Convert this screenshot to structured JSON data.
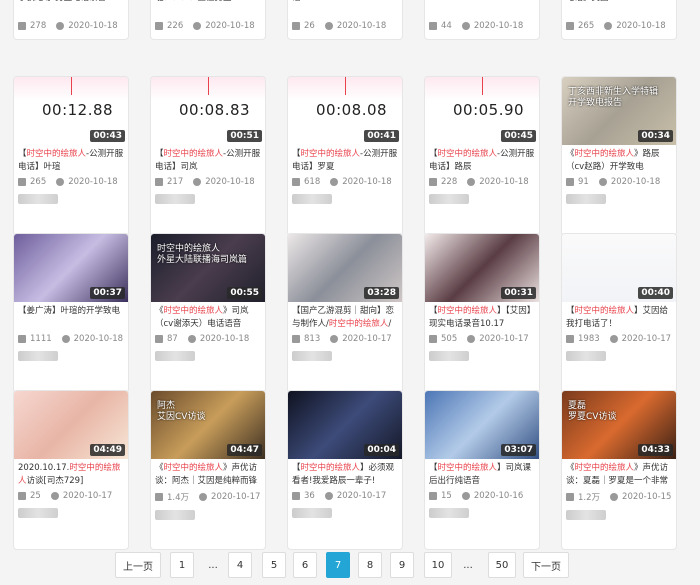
{
  "top_row": [
    {
      "title_pre": "",
      "title_hl": "",
      "title_text": "尔获绝等-男主电话录音",
      "plays": "278",
      "date": "2020-10-18"
    },
    {
      "title_pre": "",
      "title_hl": "",
      "title_text": "啦！！！！五位男主",
      "plays": "226",
      "date": "2020-10-18"
    },
    {
      "title_pre": "",
      "title_hl": "",
      "title_text": "话",
      "plays": "26",
      "date": "2020-10-18"
    },
    {
      "title_pre": "",
      "title_hl": "",
      "title_text": "",
      "plays": "44",
      "date": "2020-10-18"
    },
    {
      "title_pre": "",
      "title_hl": "",
      "title_text": "电话】艾因",
      "plays": "265",
      "date": "2020-10-18"
    }
  ],
  "cards": [
    {
      "dur": "00:43",
      "time": "00:12.88",
      "pre": "【",
      "hl": "时空中的绘旅人",
      "text": "-公测开服电话】叶瑄",
      "plays": "265",
      "date": "2020-10-18",
      "kind": "wave"
    },
    {
      "dur": "00:51",
      "time": "00:08.83",
      "pre": "【",
      "hl": "时空中的绘旅人",
      "text": "-公测开服电话】司岚",
      "plays": "217",
      "date": "2020-10-18",
      "kind": "wave"
    },
    {
      "dur": "00:41",
      "time": "00:08.08",
      "pre": "【",
      "hl": "时空中的绘旅人",
      "text": "-公测开服电话】罗夏",
      "plays": "618",
      "date": "2020-10-18",
      "kind": "wave"
    },
    {
      "dur": "00:45",
      "time": "00:05.90",
      "pre": "【",
      "hl": "时空中的绘旅人",
      "text": "-公测开服电话】路辰",
      "plays": "228",
      "date": "2020-10-18",
      "kind": "wave"
    },
    {
      "dur": "00:34",
      "time": "",
      "pre": "《",
      "hl": "时空中的绘旅人",
      "text": "》路辰（cv赵路）开学致电",
      "plays": "91",
      "date": "2020-10-18",
      "kind": "img1"
    },
    {
      "dur": "00:37",
      "time": "",
      "pre": "【姜广涛】叶瑄的开学致电",
      "hl": "",
      "text": "",
      "plays": "1111",
      "date": "2020-10-18",
      "kind": "img2"
    },
    {
      "dur": "00:55",
      "time": "",
      "pre": "《",
      "hl": "时空中的绘旅人",
      "text": "》司岚（cv谢添天）电话语音",
      "plays": "87",
      "date": "2020-10-18",
      "kind": "img3"
    },
    {
      "dur": "03:28",
      "time": "",
      "pre": "【国产乙游混剪｜甜向】恋与制作人/",
      "hl": "时空中的绘旅人",
      "text": "/",
      "plays": "813",
      "date": "2020-10-17",
      "kind": "img4"
    },
    {
      "dur": "00:31",
      "time": "",
      "pre": "【",
      "hl": "时空中的绘旅人",
      "text": "】【艾因】现实电话录音10.17",
      "plays": "505",
      "date": "2020-10-17",
      "kind": "img5"
    },
    {
      "dur": "00:40",
      "time": "",
      "pre": "【",
      "hl": "时空中的绘旅人",
      "text": "】艾因给我打电话了！",
      "plays": "1983",
      "date": "2020-10-17",
      "kind": "img6"
    },
    {
      "dur": "04:49",
      "time": "",
      "pre": "2020.10.17.",
      "hl": "时空中的绘旅人",
      "text": "访谈[司杰729]",
      "plays": "25",
      "date": "2020-10-17",
      "kind": "img7"
    },
    {
      "dur": "04:47",
      "time": "",
      "pre": "《",
      "hl": "时空中的绘旅人",
      "text": "》声优访谈：阿杰｜艾因是纯粹而锋",
      "plays": "1.4万",
      "date": "2020-10-17",
      "kind": "img8"
    },
    {
      "dur": "00:04",
      "time": "",
      "pre": "【",
      "hl": "时空中的绘旅人",
      "text": "】必须观看者!我爱路辰一辈子!",
      "plays": "36",
      "date": "2020-10-17",
      "kind": "img9"
    },
    {
      "dur": "03:07",
      "time": "",
      "pre": "【",
      "hl": "时空中的绘旅人",
      "text": "】司岚课后出行纯语音",
      "plays": "15",
      "date": "2020-10-16",
      "kind": "img10"
    },
    {
      "dur": "04:33",
      "time": "",
      "pre": "《",
      "hl": "时空中的绘旅人",
      "text": "》声优访谈：夏磊｜罗夏是一个非常",
      "plays": "1.2万",
      "date": "2020-10-15",
      "kind": "img11"
    }
  ],
  "thumb_text": {
    "img3": "时空中的绘旅人\n外星大陆联播海司岚篇",
    "img8": "阿杰\n艾因CV访谈",
    "img11": "夏磊\n罗夏CV访谈",
    "img1": "丁亥西非新生入学特辑\n开学致电报告"
  },
  "pager": {
    "prev": "上一页",
    "next": "下一页",
    "pages": [
      "1",
      "...",
      "4",
      "5",
      "6",
      "7",
      "8",
      "9",
      "10",
      "...",
      "50"
    ],
    "active": "7"
  },
  "colors": {
    "accent": "#23a6d5",
    "highlight": "#e8434c"
  }
}
